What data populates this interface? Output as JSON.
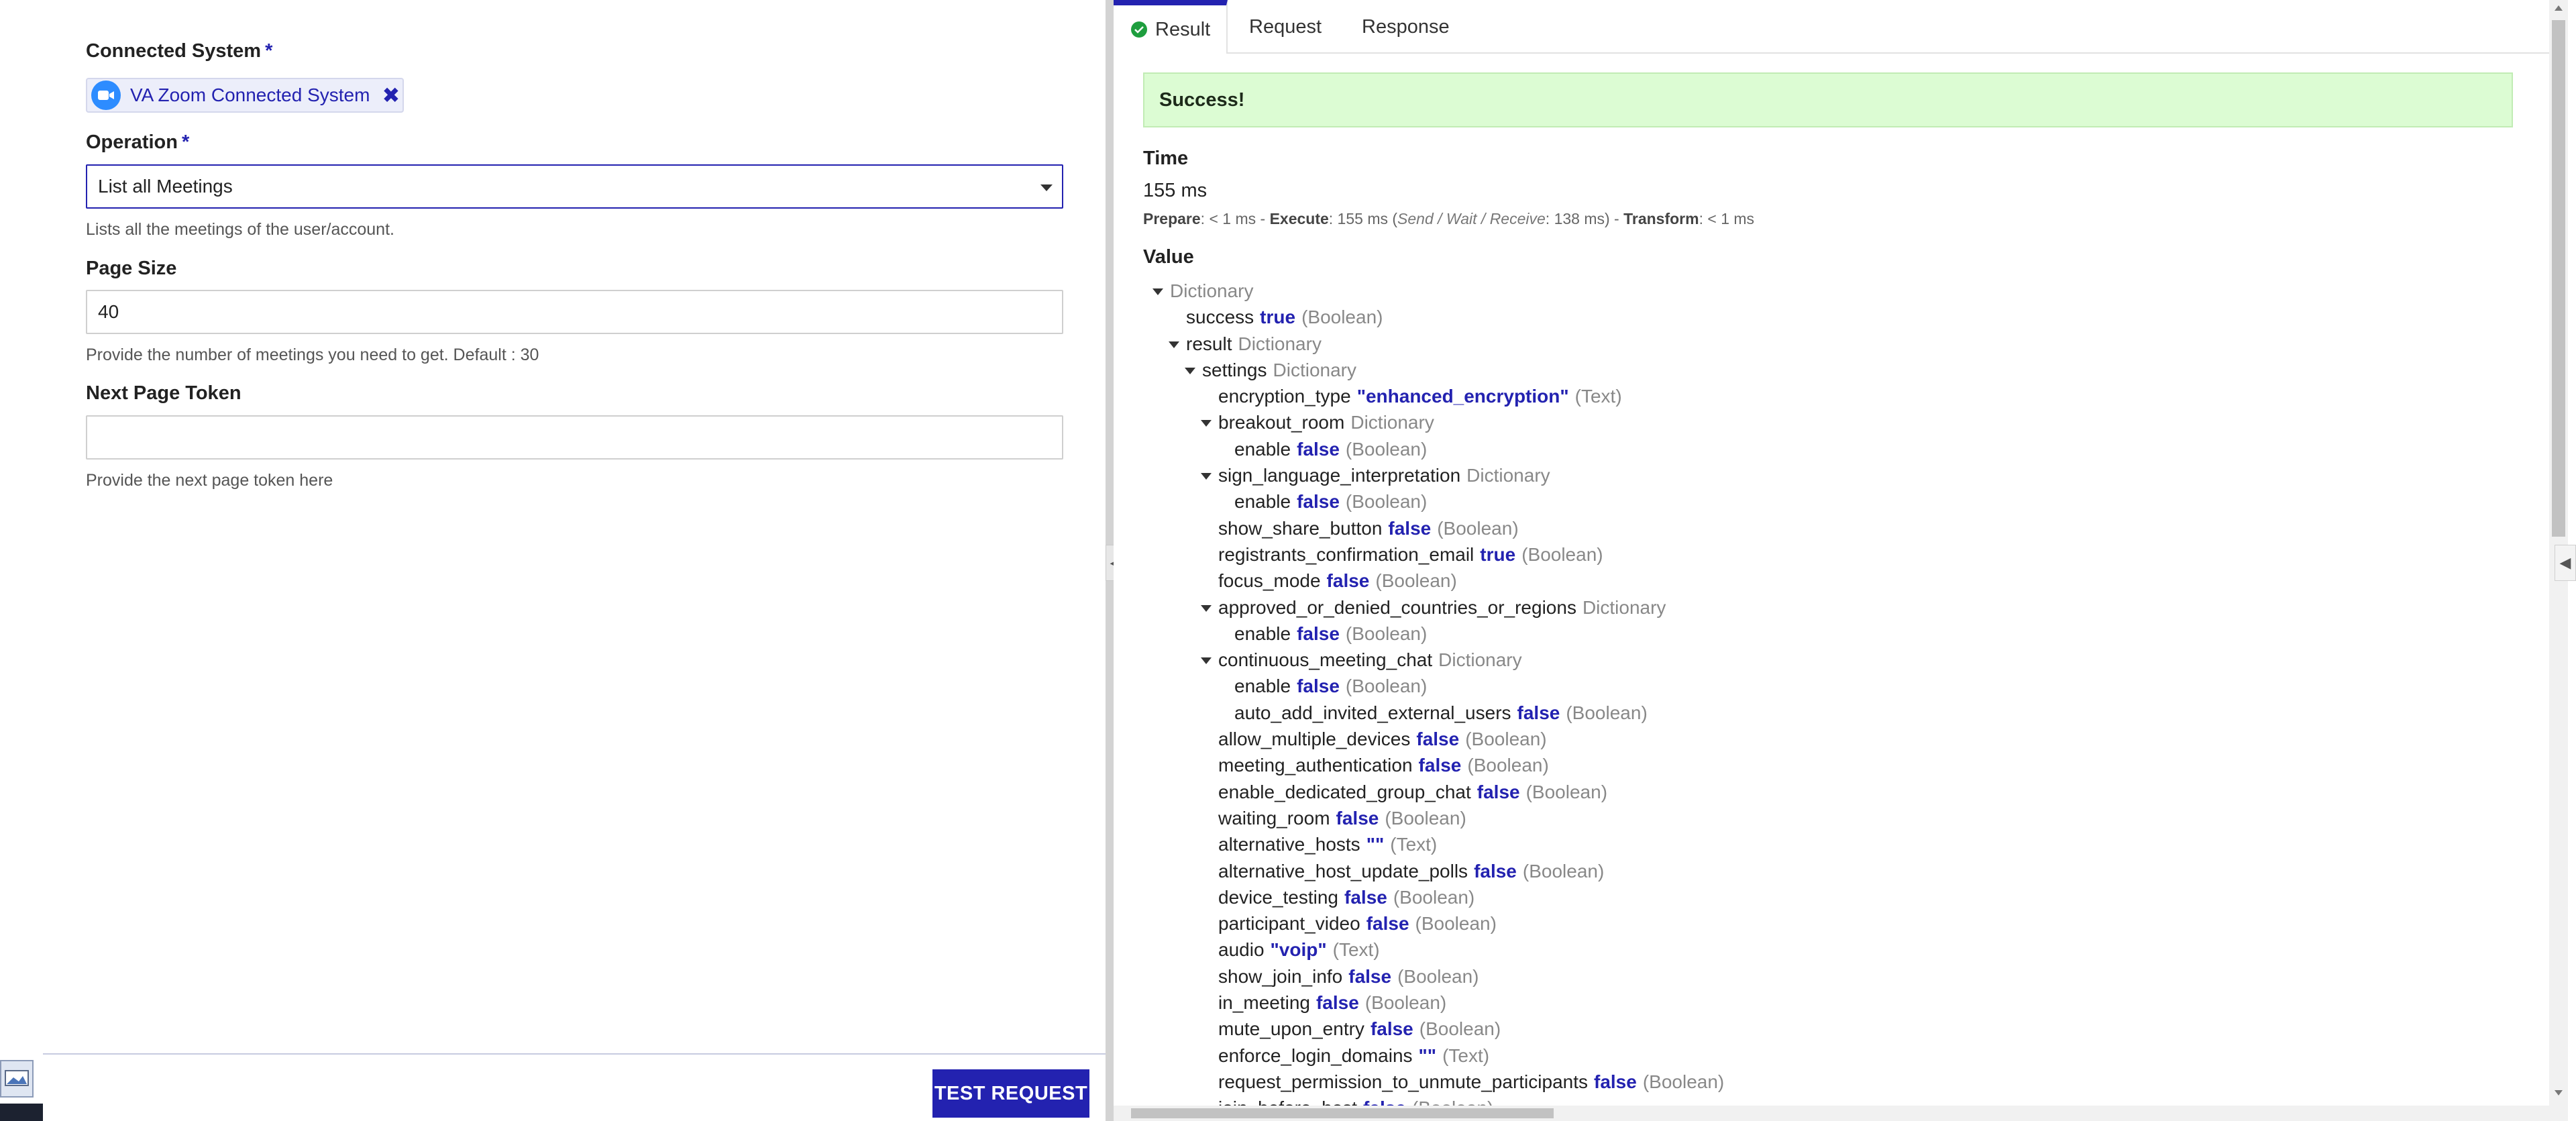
{
  "form": {
    "connected_system": {
      "label": "Connected System",
      "required_mark": "*",
      "chip_label": "VA Zoom Connected System",
      "remove_symbol": "✖",
      "icon": "zoom-camera-icon"
    },
    "operation": {
      "label": "Operation",
      "required_mark": "*",
      "value": "List all Meetings",
      "help": "Lists all the meetings of the user/account."
    },
    "page_size": {
      "label": "Page Size",
      "value": "40",
      "help": "Provide the number of meetings you need to get. Default : 30"
    },
    "next_page_token": {
      "label": "Next Page Token",
      "value": "",
      "help": "Provide the next page token here"
    },
    "test_request_label": "TEST REQUEST"
  },
  "tabs": {
    "result": "Result",
    "request": "Request",
    "response": "Response"
  },
  "result": {
    "banner": "Success!",
    "time_label": "Time",
    "time_value": "155 ms",
    "timing": {
      "prepare_label": "Prepare",
      "prepare_value": ": < 1 ms - ",
      "execute_label": "Execute",
      "execute_value": ": 155 ms (",
      "swr_label": "Send / Wait / Receive",
      "swr_value": ": 138 ms) - ",
      "transform_label": "Transform",
      "transform_value": ": < 1 ms"
    },
    "value_label": "Value",
    "tree": [
      {
        "depth": 0,
        "expand": true,
        "key": "",
        "dict": "Dictionary"
      },
      {
        "depth": 1,
        "key": "success",
        "val": "true",
        "type": "(Boolean)"
      },
      {
        "depth": 1,
        "expand": true,
        "key": "result",
        "dict": "Dictionary"
      },
      {
        "depth": 2,
        "expand": true,
        "key": "settings",
        "dict": "Dictionary"
      },
      {
        "depth": 3,
        "key": "encryption_type",
        "val": "\"enhanced_encryption\"",
        "type": "(Text)"
      },
      {
        "depth": 3,
        "expand": true,
        "key": "breakout_room",
        "dict": "Dictionary"
      },
      {
        "depth": 4,
        "key": "enable",
        "val": "false",
        "type": "(Boolean)"
      },
      {
        "depth": 3,
        "expand": true,
        "key": "sign_language_interpretation",
        "dict": "Dictionary"
      },
      {
        "depth": 4,
        "key": "enable",
        "val": "false",
        "type": "(Boolean)"
      },
      {
        "depth": 3,
        "key": "show_share_button",
        "val": "false",
        "type": "(Boolean)"
      },
      {
        "depth": 3,
        "key": "registrants_confirmation_email",
        "val": "true",
        "type": "(Boolean)"
      },
      {
        "depth": 3,
        "key": "focus_mode",
        "val": "false",
        "type": "(Boolean)"
      },
      {
        "depth": 3,
        "expand": true,
        "key": "approved_or_denied_countries_or_regions",
        "dict": "Dictionary"
      },
      {
        "depth": 4,
        "key": "enable",
        "val": "false",
        "type": "(Boolean)"
      },
      {
        "depth": 3,
        "expand": true,
        "key": "continuous_meeting_chat",
        "dict": "Dictionary"
      },
      {
        "depth": 4,
        "key": "enable",
        "val": "false",
        "type": "(Boolean)"
      },
      {
        "depth": 4,
        "key": "auto_add_invited_external_users",
        "val": "false",
        "type": "(Boolean)"
      },
      {
        "depth": 3,
        "key": "allow_multiple_devices",
        "val": "false",
        "type": "(Boolean)"
      },
      {
        "depth": 3,
        "key": "meeting_authentication",
        "val": "false",
        "type": "(Boolean)"
      },
      {
        "depth": 3,
        "key": "enable_dedicated_group_chat",
        "val": "false",
        "type": "(Boolean)"
      },
      {
        "depth": 3,
        "key": "waiting_room",
        "val": "false",
        "type": "(Boolean)"
      },
      {
        "depth": 3,
        "key": "alternative_hosts",
        "val": "\"\"",
        "type": "(Text)"
      },
      {
        "depth": 3,
        "key": "alternative_host_update_polls",
        "val": "false",
        "type": "(Boolean)"
      },
      {
        "depth": 3,
        "key": "device_testing",
        "val": "false",
        "type": "(Boolean)"
      },
      {
        "depth": 3,
        "key": "participant_video",
        "val": "false",
        "type": "(Boolean)"
      },
      {
        "depth": 3,
        "key": "audio",
        "val": "\"voip\"",
        "type": "(Text)"
      },
      {
        "depth": 3,
        "key": "show_join_info",
        "val": "false",
        "type": "(Boolean)"
      },
      {
        "depth": 3,
        "key": "in_meeting",
        "val": "false",
        "type": "(Boolean)"
      },
      {
        "depth": 3,
        "key": "mute_upon_entry",
        "val": "false",
        "type": "(Boolean)"
      },
      {
        "depth": 3,
        "key": "enforce_login_domains",
        "val": "\"\"",
        "type": "(Text)"
      },
      {
        "depth": 3,
        "key": "request_permission_to_unmute_participants",
        "val": "false",
        "type": "(Boolean)"
      },
      {
        "depth": 3,
        "key": "join_before_host",
        "val": "false",
        "type": "(Boolean)"
      }
    ]
  },
  "colors": {
    "accent": "#2322b0",
    "success_bg": "#dcfcd3",
    "success_check": "#1e9e3e",
    "zoom_blue": "#2d8cff"
  },
  "icons": {
    "collapse_left": "chevron-left-icon",
    "collapse_right": "chevron-left-icon",
    "result_tab": "check-circle-icon"
  }
}
